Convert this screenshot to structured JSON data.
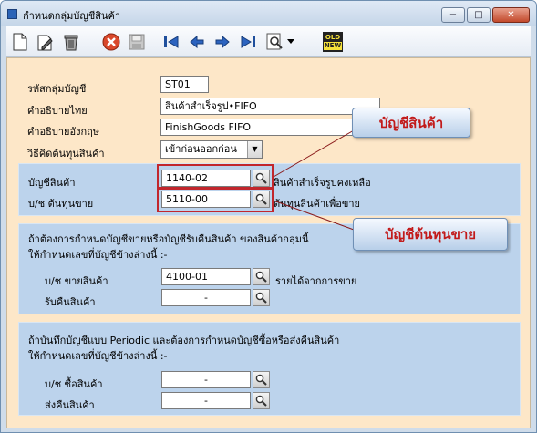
{
  "window": {
    "title": "กำหนดกลุ่มบัญชีสินค้า"
  },
  "titlebar_buttons": {
    "minimize": "−",
    "maximize": "□",
    "close": "✕"
  },
  "toolbar": {
    "icons": [
      "new-document-icon",
      "edit-icon",
      "trash-icon",
      "cancel-icon",
      "save-icon",
      "first-record-icon",
      "previous-record-icon",
      "next-record-icon",
      "last-record-icon",
      "search-icon",
      "dropdown-arrow-icon",
      "old-new-icon"
    ],
    "old_label": "OLD",
    "new_label": "NEW"
  },
  "form": {
    "code_label": "รหัสกลุ่มบัญชี",
    "code_value": "ST01",
    "desc_th_label": "คำอธิบายไทย",
    "desc_th_value": "สินค้าสำเร็จรูป•FIFO",
    "desc_en_label": "คำอธิบายอังกฤษ",
    "desc_en_value": "FinishGoods FIFO",
    "costing_label": "วิธีคิดต้นทุนสินค้า",
    "costing_value": "เข้าก่อนออกก่อน"
  },
  "inventory_panel": {
    "inventory_label": "บัญชีสินค้า",
    "inventory_value": "1140-02",
    "inventory_desc": "สินค้าสำเร็จรูปคงเหลือ",
    "cogs_label": "บ/ช ต้นทุนขาย",
    "cogs_value": "5110-00",
    "cogs_desc": "ต้นทุนสินค้าเพื่อขาย"
  },
  "sales_panel": {
    "note_line1": "ถ้าต้องการกำหนดบัญชีขายหรือบัญชีรับคืนสินค้า ของสินค้ากลุ่มนี้",
    "note_line2": "ให้กำหนดเลขที่บัญชีข้างล่างนี้ :-",
    "sales_label": "บ/ช ขายสินค้า",
    "sales_value": "4100-01",
    "sales_desc": "รายได้จากการขาย",
    "return_label": "รับคืนสินค้า",
    "return_value": "-"
  },
  "purchase_panel": {
    "note_line1": "ถ้าบันทึกบัญชีแบบ Periodic และต้องการกำหนดบัญชีซื้อหรือส่งคืนสินค้า",
    "note_line2": "ให้กำหนดเลขที่บัญชีข้างล่างนี้ :-",
    "purchase_label": "บ/ช ซื้อสินค้า",
    "purchase_value": "-",
    "return_label": "ส่งคืนสินค้า",
    "return_value": "-"
  },
  "callouts": {
    "inventory": "บัญชีสินค้า",
    "cogs": "บัญชีต้นทุนขาย"
  },
  "colors": {
    "form_background": "#fde7c8",
    "panel_background": "#bcd3ec",
    "highlight_border": "#c2262c",
    "callout_text": "#c21a1a"
  }
}
